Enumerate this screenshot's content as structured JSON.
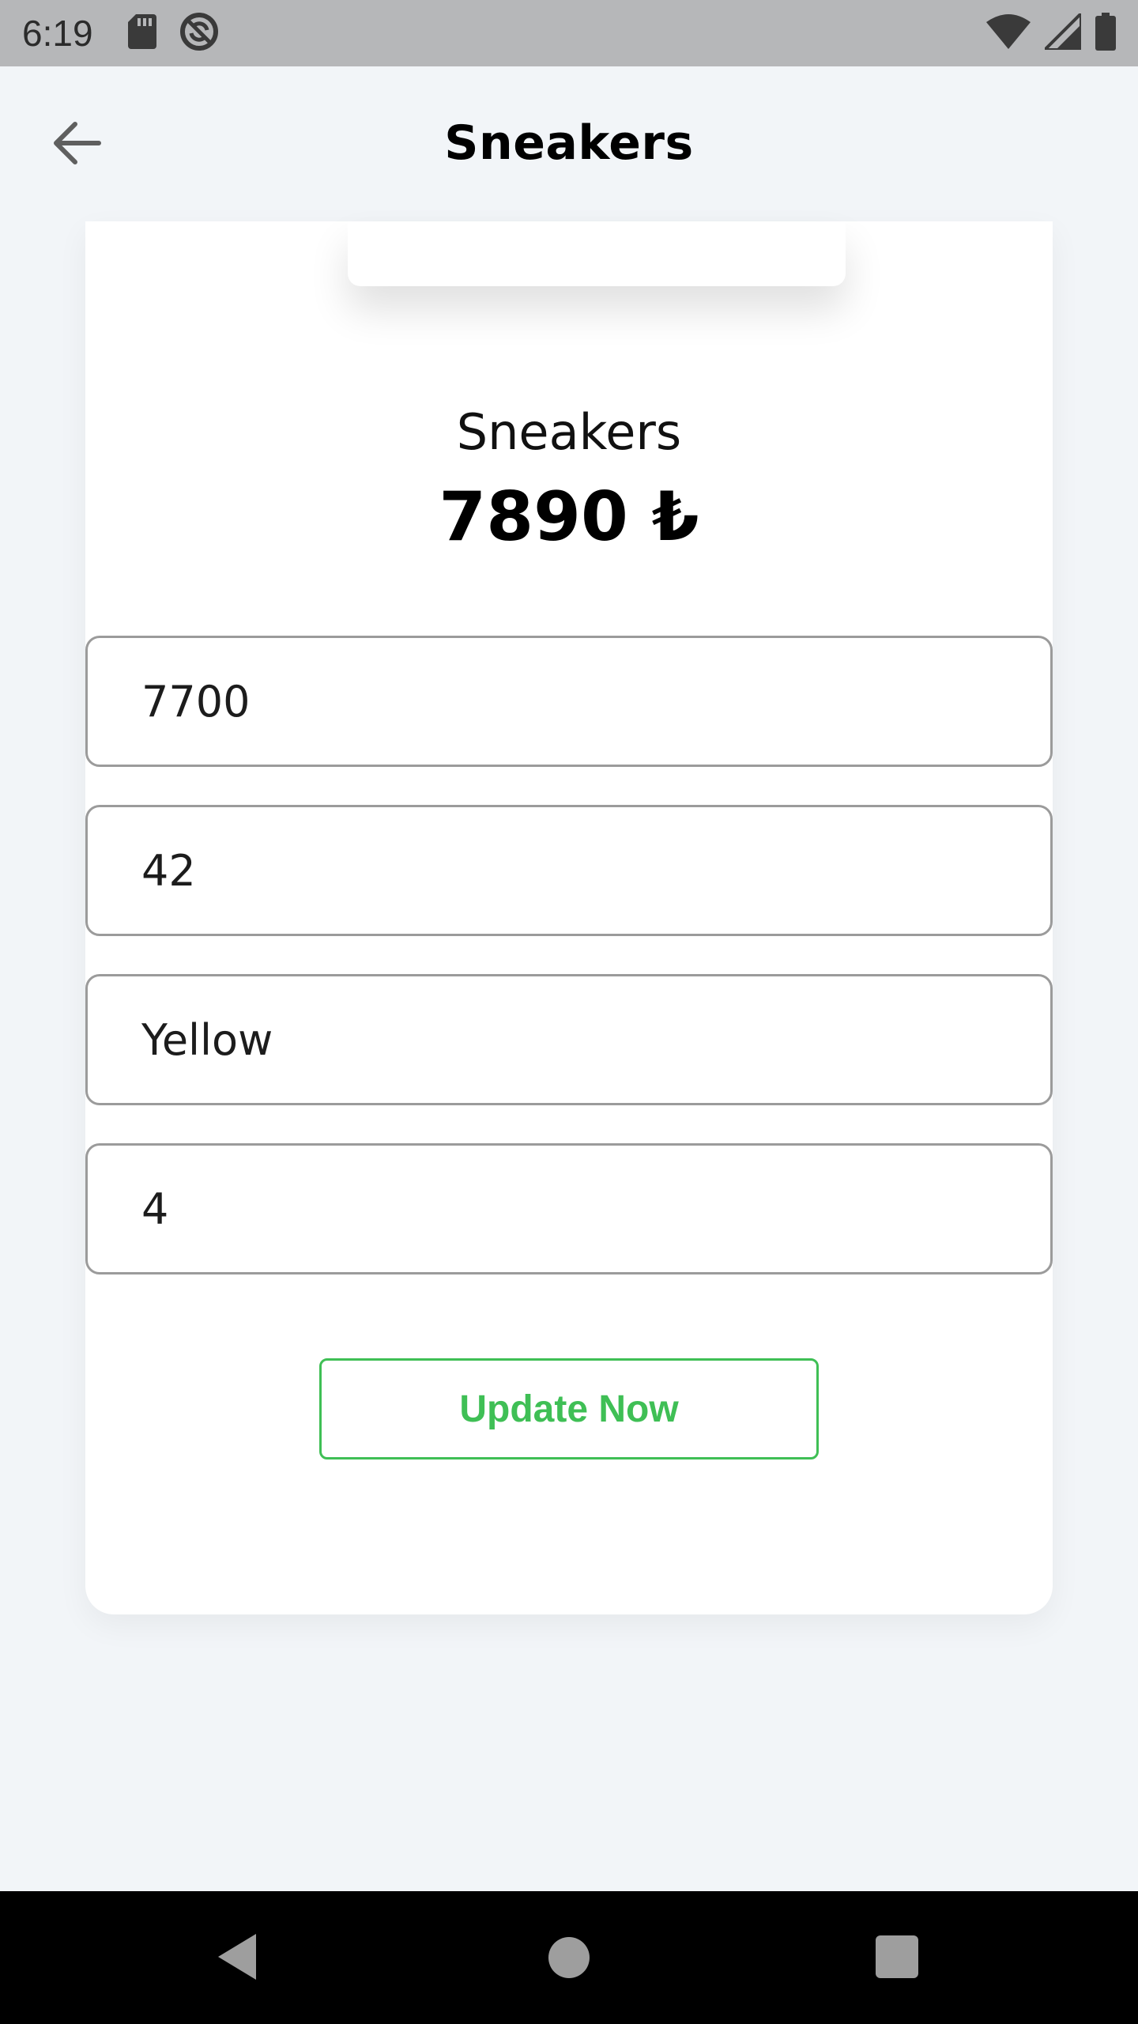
{
  "status_bar": {
    "time": "6:19",
    "left_icons": [
      "sd-card-icon",
      "no-sync-icon"
    ],
    "right_icons": [
      "wifi-icon",
      "signal-icon",
      "battery-icon"
    ]
  },
  "app_bar": {
    "title": "Sneakers",
    "back_icon": "arrow-left-icon"
  },
  "product": {
    "name": "Sneakers",
    "price": "7890 ₺"
  },
  "form": {
    "price_value": "7700",
    "size_value": "42",
    "color_value": "Yellow",
    "stock_value": "4"
  },
  "update_button": {
    "label": "Update Now"
  },
  "nav_bar": {
    "icons": [
      "back-triangle-icon",
      "home-circle-icon",
      "recents-square-icon"
    ]
  },
  "colors": {
    "background": "#f2f5f8",
    "accent_green": "#3fbf55",
    "status_bar": "#b6b7b9"
  }
}
